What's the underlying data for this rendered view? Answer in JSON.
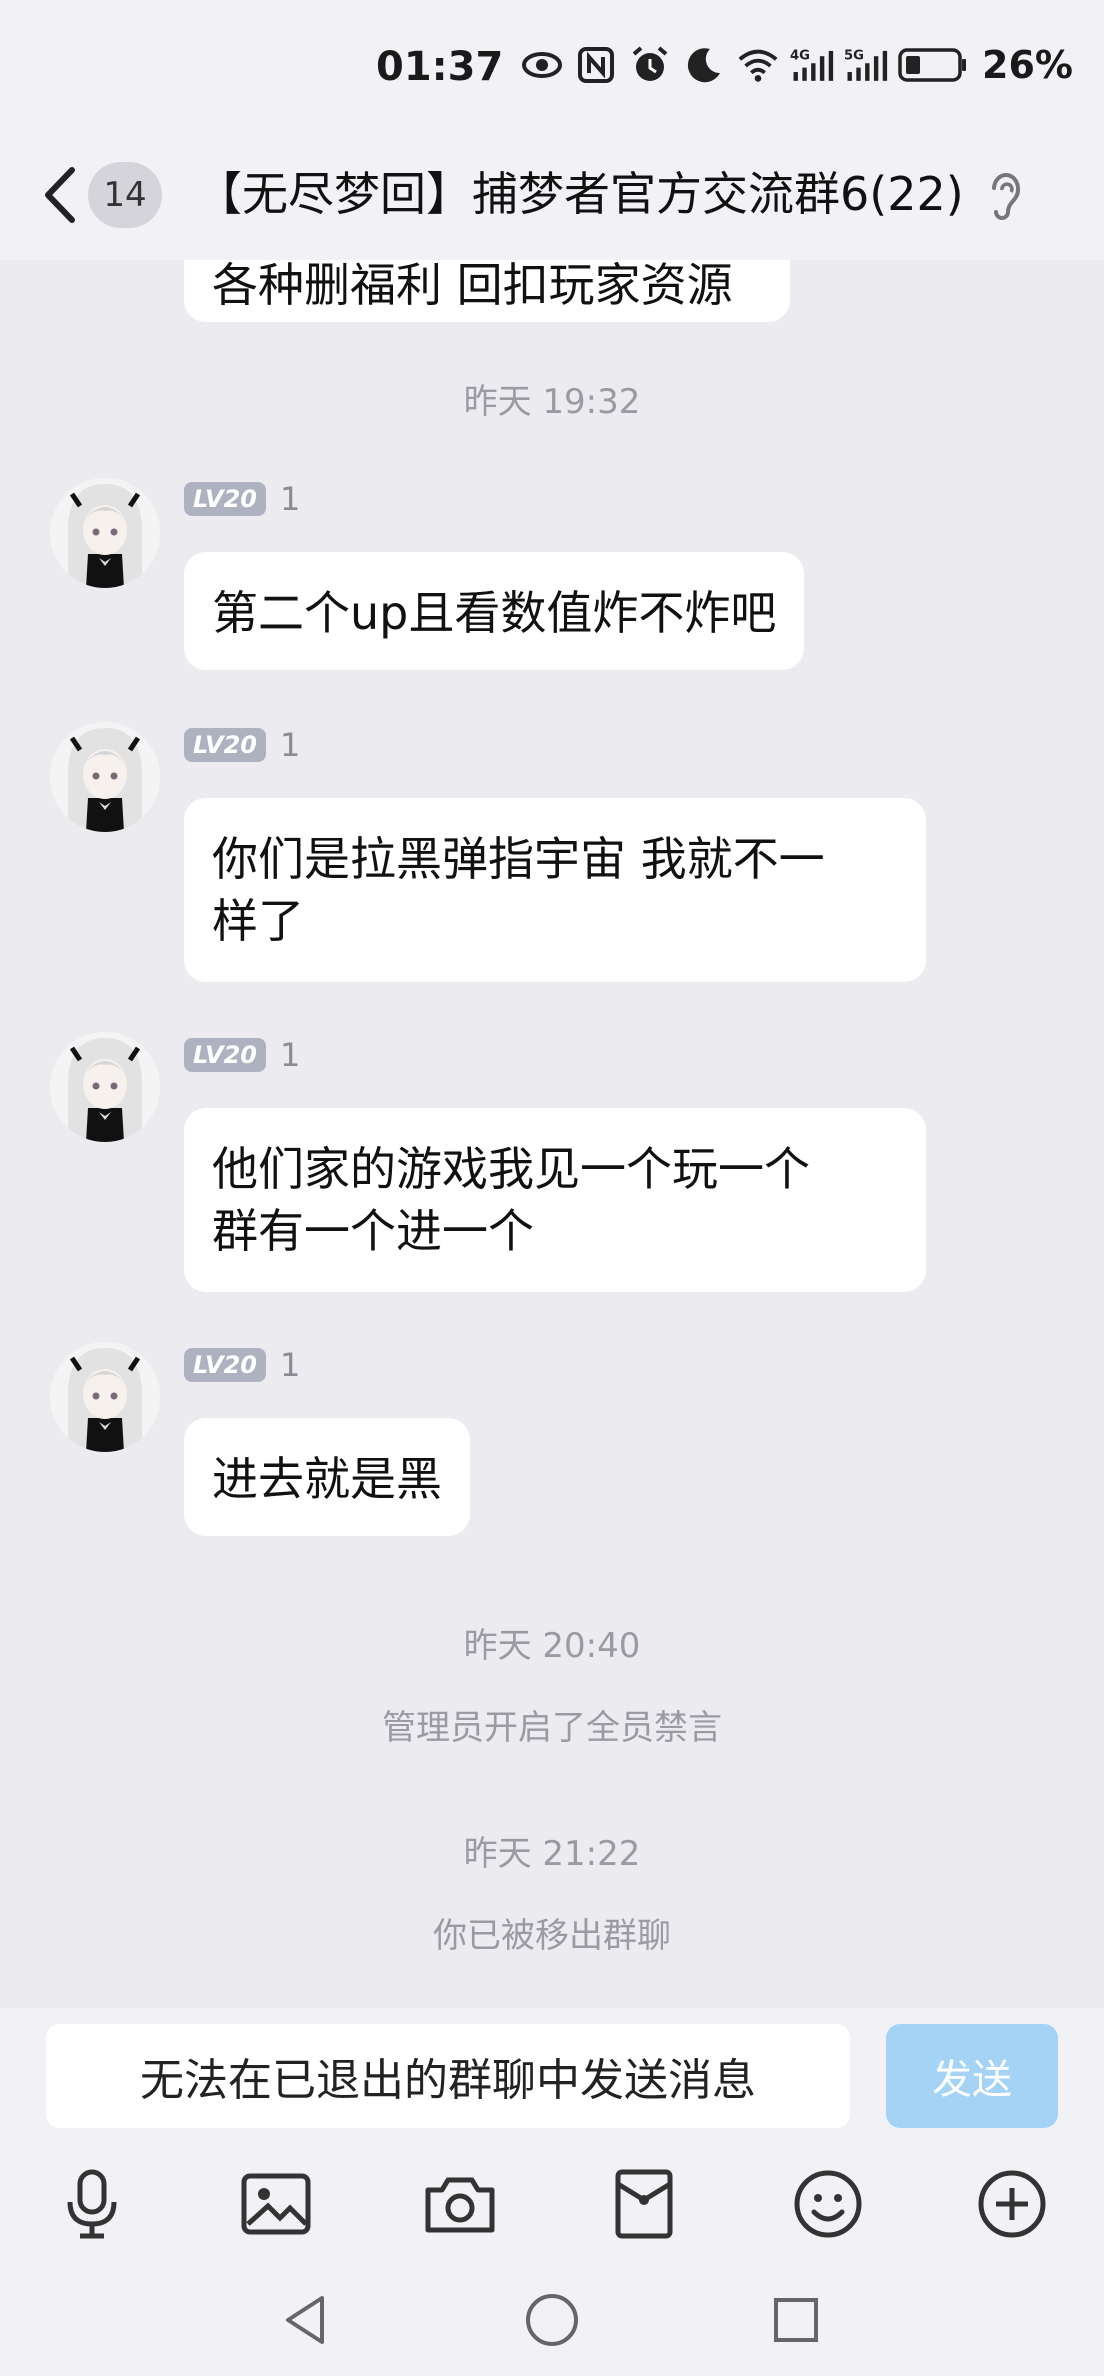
{
  "status_bar": {
    "time": "01:37",
    "battery": "26%",
    "icons": [
      "eye-icon",
      "nfc-icon",
      "alarm-icon",
      "moon-icon",
      "wifi-icon",
      "signal-4g-icon",
      "signal-5g-icon",
      "battery-icon"
    ]
  },
  "header": {
    "unread_count": "14",
    "title": "【无尽梦回】捕梦者官方交流群6(22)"
  },
  "chat": {
    "partial_top_message": "各种删福利 回扣玩家资源",
    "items": [
      {
        "type": "timestamp",
        "text": "昨天 19:32"
      },
      {
        "type": "message",
        "level": "LV20",
        "sender": "1",
        "text": "第二个up且看数值炸不炸吧"
      },
      {
        "type": "message",
        "level": "LV20",
        "sender": "1",
        "line1": "你们是拉黑弹指宇宙 我就不一",
        "line2": "样了"
      },
      {
        "type": "message",
        "level": "LV20",
        "sender": "1",
        "line1": "他们家的游戏我见一个玩一个",
        "line2": "群有一个进一个"
      },
      {
        "type": "message",
        "level": "LV20",
        "sender": "1",
        "text": "进去就是黑"
      },
      {
        "type": "timestamp",
        "text": "昨天 20:40"
      },
      {
        "type": "system",
        "text": "管理员开启了全员禁言"
      },
      {
        "type": "timestamp",
        "text": "昨天 21:22"
      },
      {
        "type": "system",
        "text": "你已被移出群聊"
      }
    ]
  },
  "input": {
    "placeholder": "无法在已退出的群聊中发送消息",
    "send_label": "发送"
  },
  "toolbar": [
    "microphone-icon",
    "image-icon",
    "camera-icon",
    "red-packet-icon",
    "emoji-icon",
    "plus-icon"
  ],
  "navbar": [
    "back-nav-icon",
    "home-nav-icon",
    "recents-nav-icon"
  ],
  "colors": {
    "background": "#ebebf0",
    "bubble": "#ffffff",
    "send_button": "#a5d3f5",
    "level_badge": "#aeb2c0"
  }
}
